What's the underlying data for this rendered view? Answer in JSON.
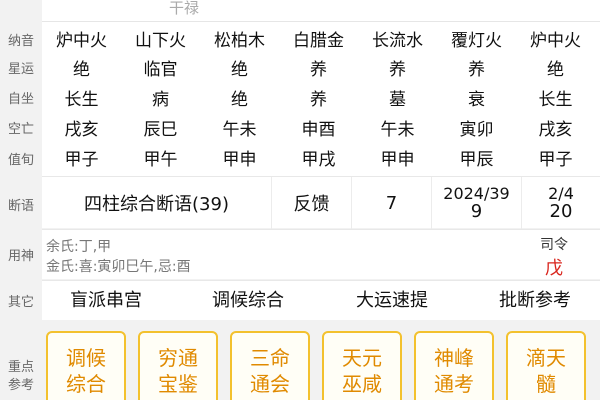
{
  "header": {
    "title": "干禄"
  },
  "row_labels": {
    "nayin": "纳音",
    "xingyun": "星运",
    "zizuo": "自坐",
    "kongwang": "空亡",
    "xunshou": "值旬",
    "duanyu": "断语",
    "yongshen": "用神",
    "qita": "其它",
    "ref_line1": "重点",
    "ref_line2": "参考"
  },
  "columns": [
    {
      "nayin": "炉中火",
      "xingyun": "绝",
      "zizuo": "长生",
      "kongwang": "戌亥",
      "xunshou": "甲子"
    },
    {
      "nayin": "山下火",
      "xingyun": "临官",
      "zizuo": "病",
      "kongwang": "辰巳",
      "xunshou": "甲午"
    },
    {
      "nayin": "松柏木",
      "xingyun": "绝",
      "zizuo": "绝",
      "kongwang": "午未",
      "xunshou": "甲申"
    },
    {
      "nayin": "白腊金",
      "xingyun": "养",
      "zizuo": "养",
      "kongwang": "申酉",
      "xunshou": "甲戌"
    },
    {
      "nayin": "长流水",
      "xingyun": "养",
      "zizuo": "墓",
      "kongwang": "午未",
      "xunshou": "甲申"
    },
    {
      "nayin": "覆灯火",
      "xingyun": "养",
      "zizuo": "衰",
      "kongwang": "寅卯",
      "xunshou": "甲辰"
    },
    {
      "nayin": "炉中火",
      "xingyun": "绝",
      "zizuo": "长生",
      "kongwang": "戌亥",
      "xunshou": "甲子"
    }
  ],
  "duanyu": {
    "summary": "四柱综合断语(39)",
    "feedback": "反馈",
    "count": "7",
    "date_line1": "2024/39",
    "date_line2": "9",
    "frac_line1": "2/4",
    "frac_line2": "20"
  },
  "yongshen": {
    "line1": "余氏:丁,甲",
    "line2": "金氏:喜:寅卯巳午,忌:酉",
    "siling_label": "司令",
    "siling_value": "戊"
  },
  "qita_buttons": [
    "盲派串宫",
    "调候综合",
    "大运速提",
    "批断参考"
  ],
  "ref_cards": [
    {
      "line1": "调候",
      "line2": "综合"
    },
    {
      "line1": "穷通",
      "line2": "宝鉴"
    },
    {
      "line1": "三命",
      "line2": "通会"
    },
    {
      "line1": "天元",
      "line2": "巫咸"
    },
    {
      "line1": "神峰",
      "line2": "通考"
    },
    {
      "line1": "滴天",
      "line2": "髓"
    }
  ],
  "colors": {
    "accent_red": "#d9251d",
    "card_border": "#f3c12e",
    "card_text": "#e08a00"
  }
}
